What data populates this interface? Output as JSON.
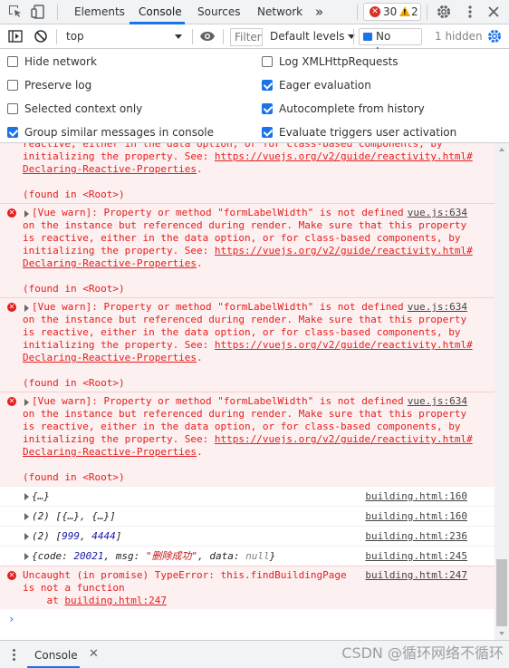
{
  "tabs": {
    "elements": "Elements",
    "console": "Console",
    "sources": "Sources",
    "network": "Network",
    "more": "»",
    "error_count": "30",
    "warning_count": "2"
  },
  "toolbar": {
    "context": "top",
    "filter_placeholder": "Filter",
    "levels": "Default levels",
    "no_issue": "No Issue",
    "hidden": "1 hidden"
  },
  "settings": [
    {
      "label": "Hide network",
      "checked": false
    },
    {
      "label": "Log XMLHttpRequests",
      "checked": false
    },
    {
      "label": "Preserve log",
      "checked": false
    },
    {
      "label": "Eager evaluation",
      "checked": true
    },
    {
      "label": "Selected context only",
      "checked": false
    },
    {
      "label": "Autocomplete from history",
      "checked": true
    },
    {
      "label": "Group similar messages in console",
      "checked": true
    },
    {
      "label": "Evaluate triggers user activation",
      "checked": true
    }
  ],
  "messages": {
    "top_partial": {
      "line1": "reactive, either in the data option, or for class-based components, by",
      "line2_pre": "initializing the property. See: ",
      "link": "https://vuejs.org/v2/guide/reactivity.html#",
      "link2": "Declaring-Reactive-Properties",
      "dot": ".",
      "found": "(found in <Root>)"
    },
    "warn": {
      "line1": "[Vue warn]: Property or method \"formLabelWidth\" is not defined ",
      "source": "vue.js:634",
      "line2": "on the instance but referenced during render. Make sure that this property",
      "line3": "is reactive, either in the data option, or for class-based components, by",
      "line4_pre": "initializing the property. See: ",
      "link": "https://vuejs.org/v2/guide/reactivity.html#",
      "link2": "Declaring-Reactive-Properties",
      "dot": ".",
      "found": "(found in <Root>)"
    },
    "logs": [
      {
        "text": "{…}",
        "source": "building.html:160"
      },
      {
        "text": "(2) [{…}, {…}]",
        "source": "building.html:160"
      },
      {
        "prefix": "(2) [",
        "n1": "999",
        "sep": ", ",
        "n2": "4444",
        "suffix": "]",
        "source": "building.html:236"
      },
      {
        "p1": "{code: ",
        "n": "20021",
        "p2": ", msg: ",
        "s": "\"删除成功\"",
        "p3": ", data: ",
        "nul": "null",
        "p4": "}",
        "source": "building.html:245"
      }
    ],
    "uncaught": {
      "line1": "Uncaught (in promise) TypeError: this.findBuildingPage",
      "source": "building.html:247",
      "line2": "is not a function",
      "line3_pre": "    at ",
      "line3_link": "building.html:247"
    },
    "prompt": "›"
  },
  "drawer": {
    "tab": "Console",
    "close": "✕",
    "watermark": "CSDN @循环网络不循环"
  }
}
